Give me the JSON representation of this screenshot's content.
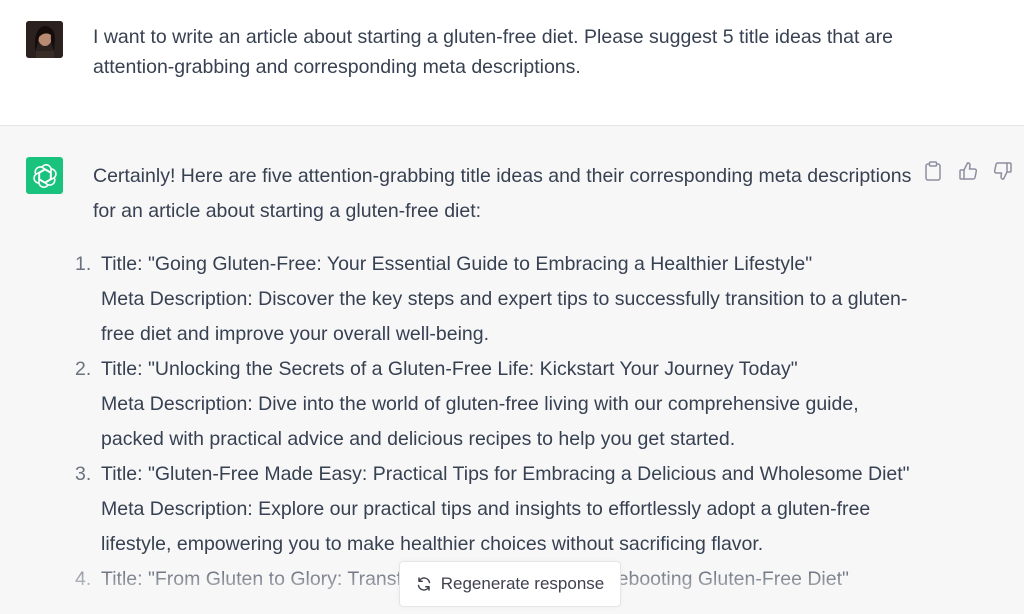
{
  "user_message": {
    "avatar": "user-avatar-photo",
    "text": "I want to write an article about starting a gluten-free diet. Please suggest 5 title ideas that are attention-grabbing and corresponding meta descriptions."
  },
  "assistant_message": {
    "logo": "chatgpt-logo-icon",
    "intro": "Certainly! Here are five attention-grabbing title ideas and their corresponding meta descriptions for an article about starting a gluten-free diet:",
    "items": [
      {
        "number": "1.",
        "title": "Title: \"Going Gluten-Free: Your Essential Guide to Embracing a Healthier Lifestyle\"",
        "meta": "Meta Description: Discover the key steps and expert tips to successfully transition to a gluten-free diet and improve your overall well-being."
      },
      {
        "number": "2.",
        "title": "Title: \"Unlocking the Secrets of a Gluten-Free Life: Kickstart Your Journey Today\"",
        "meta": "Meta Description: Dive into the world of gluten-free living with our comprehensive guide, packed with practical advice and delicious recipes to help you get started."
      },
      {
        "number": "3.",
        "title": "Title: \"Gluten-Free Made Easy: Practical Tips for Embracing a Delicious and Wholesome Diet\"",
        "meta": "Meta Description: Explore our practical tips and insights to effortlessly adopt a gluten-free lifestyle, empowering you to make healthier choices without sacrificing flavor."
      },
      {
        "number": "4.",
        "title": "Title: \"From Gluten to Glory: Transform Your Health with a Rebooting Gluten-Free Diet\"",
        "meta": ""
      }
    ]
  },
  "actions": {
    "copy": "clipboard-icon",
    "like": "thumbs-up-icon",
    "dislike": "thumbs-down-icon"
  },
  "regenerate": {
    "label": "Regenerate response",
    "icon": "refresh-icon"
  },
  "colors": {
    "accent_green": "#19c37d",
    "assistant_bg": "#f7f7f8",
    "text": "#374151"
  }
}
